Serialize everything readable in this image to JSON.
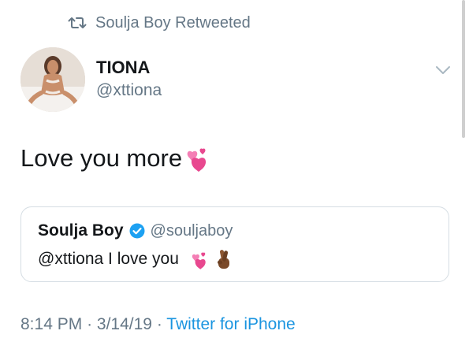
{
  "retweet_context": {
    "text": "Soulja Boy Retweeted",
    "icon": "retweet-icon"
  },
  "tweet": {
    "author_name": "TIONA",
    "author_handle": "@xttiona",
    "text": "Love you more",
    "emoji": "two-hearts-emoji",
    "menu_icon": "chevron-down-icon"
  },
  "quoted_tweet": {
    "author_name": "Soulja Boy",
    "author_handle": "@souljaboy",
    "verified_icon": "verified-badge-icon",
    "text": "@xttiona I love you",
    "emojis": [
      "two-hearts-emoji",
      "crossed-fingers-emoji"
    ]
  },
  "meta": {
    "time": "8:14 PM",
    "separator": "·",
    "date": "3/14/19",
    "source": "Twitter for iPhone"
  },
  "colors": {
    "text": "#14171a",
    "secondary": "#657786",
    "link": "#1b95e0",
    "verified": "#1da1f2",
    "border": "#d5dde3",
    "heart": "#e8488f"
  }
}
